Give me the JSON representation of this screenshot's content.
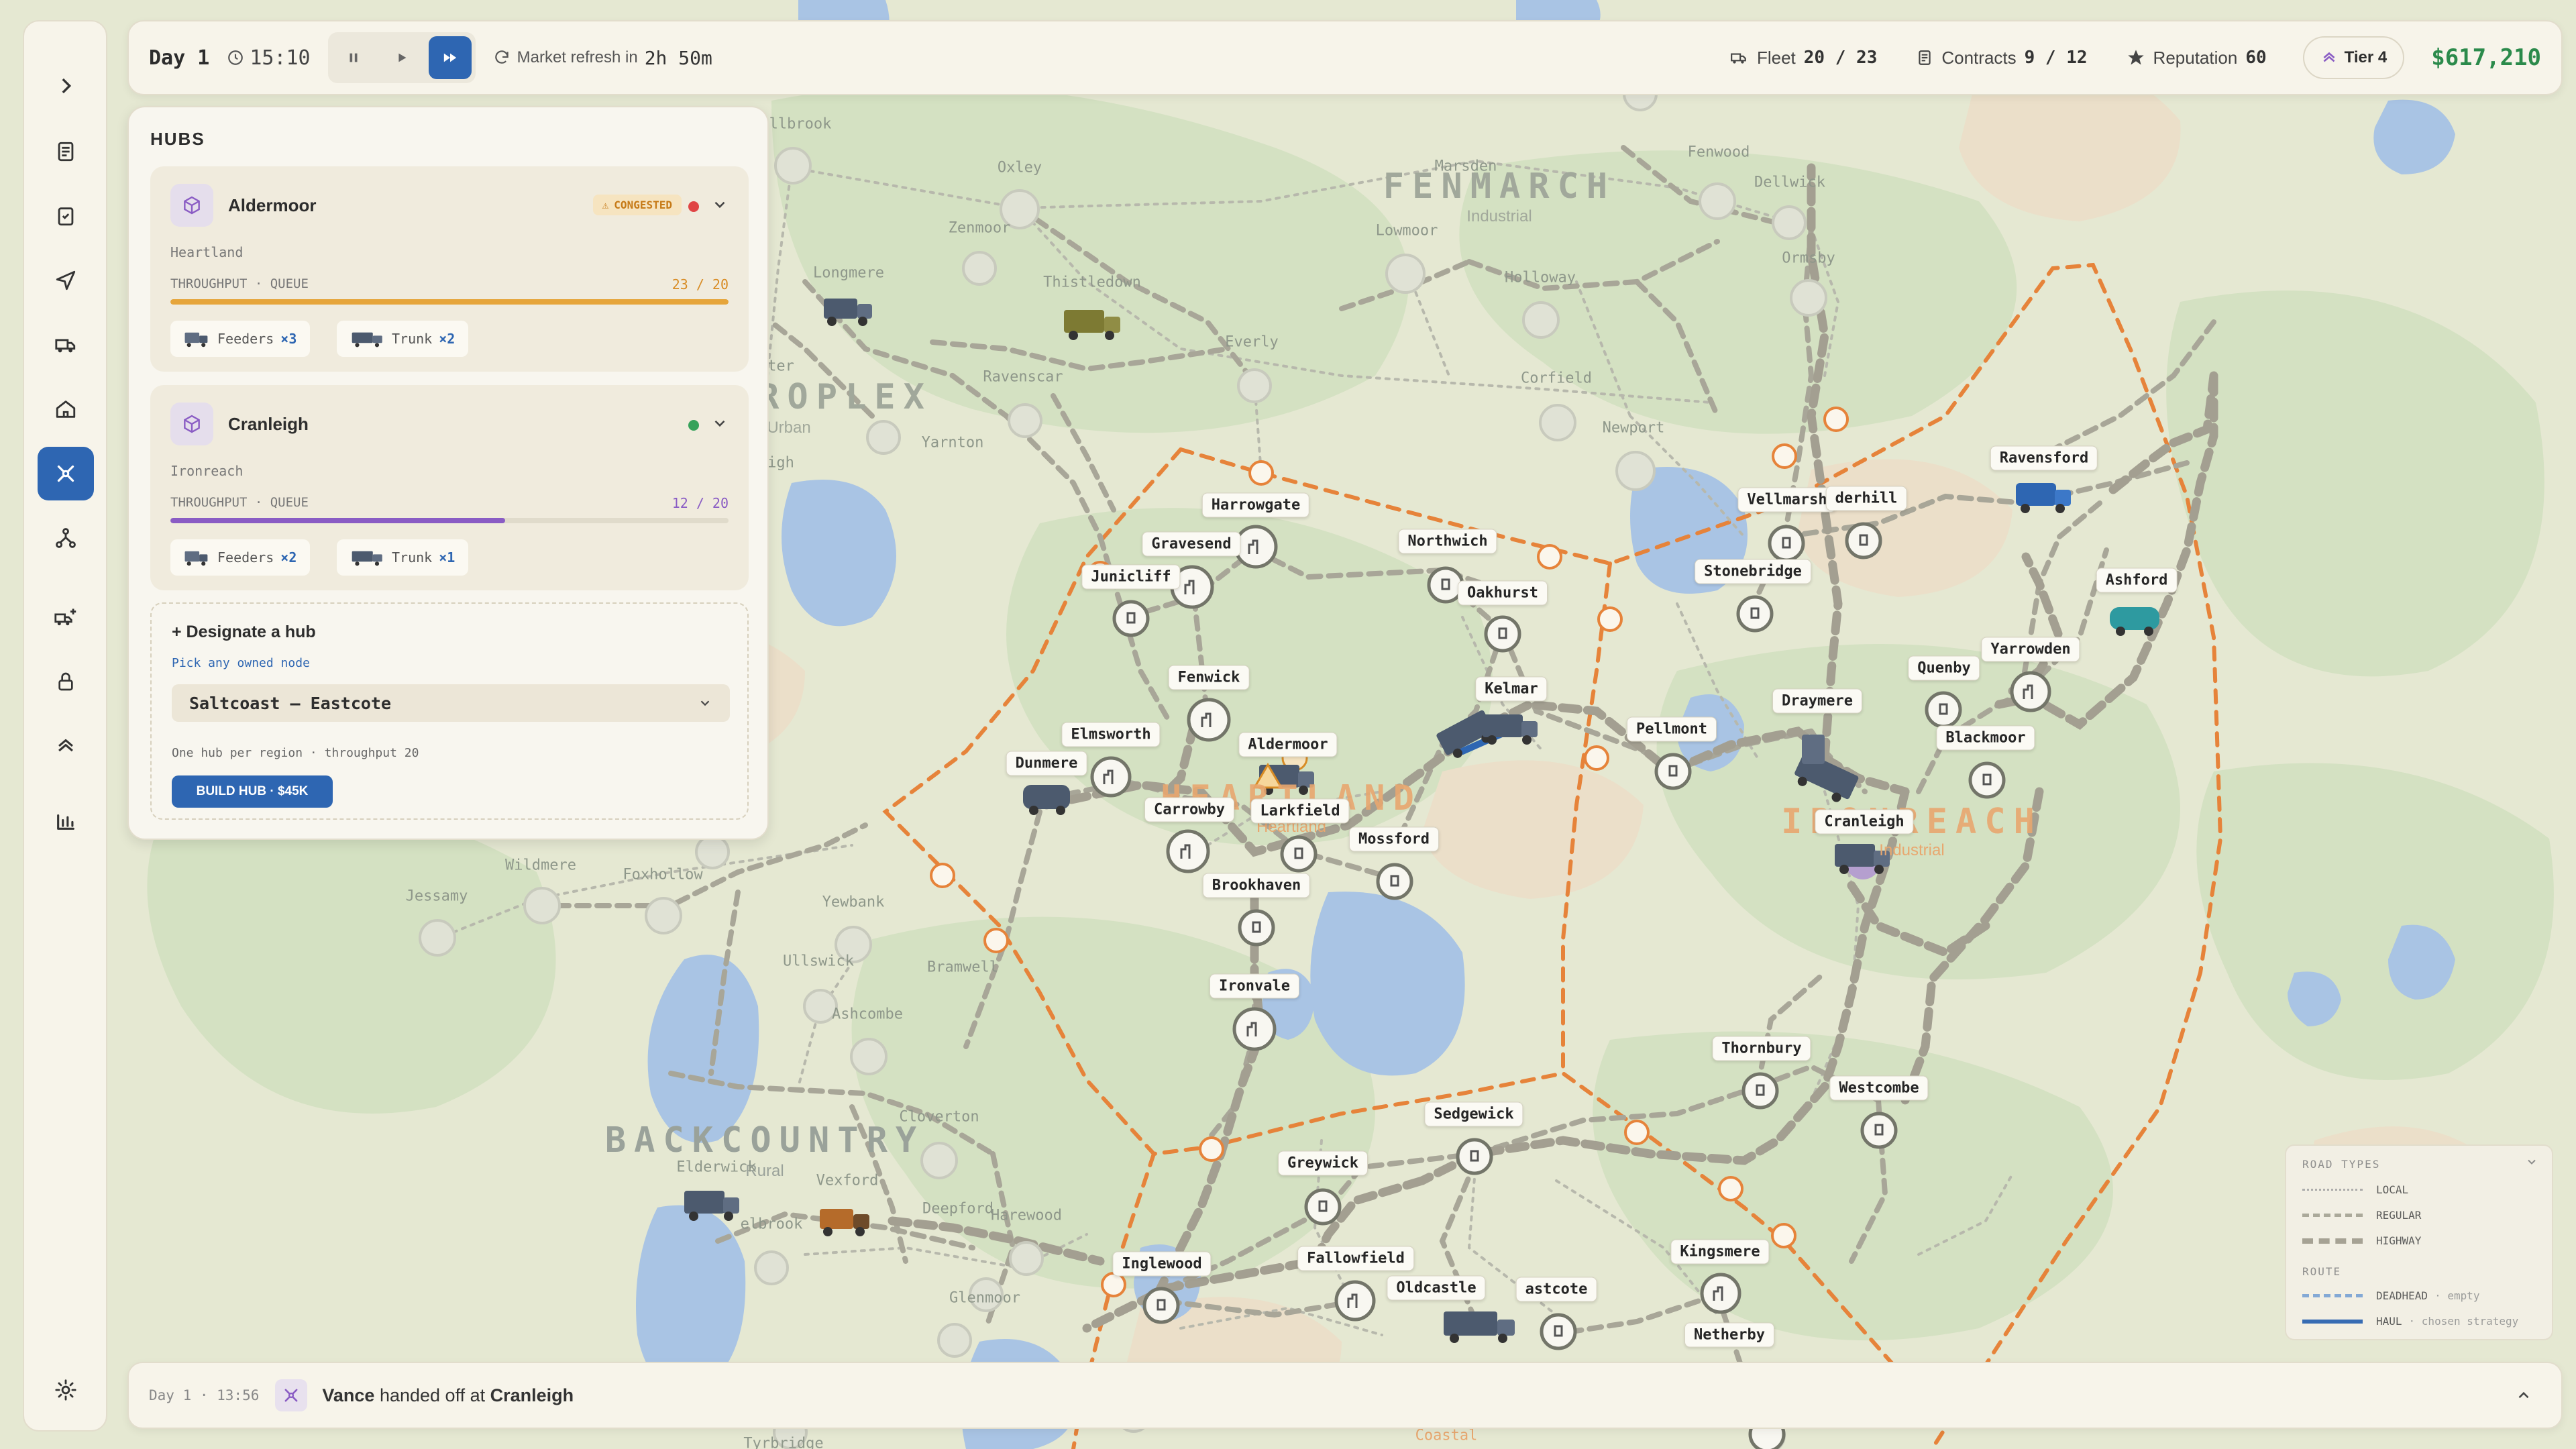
{
  "topbar": {
    "day": "Day 1",
    "time": "15:10",
    "refresh_label": "Market refresh in",
    "refresh_value": "2h 50m",
    "fleet_label": "Fleet",
    "fleet_value": "20 / 23",
    "contracts_label": "Contracts",
    "contracts_value": "9 / 12",
    "reputation_label": "Reputation",
    "reputation_value": "60",
    "tier": "Tier 4",
    "money": "$617,210"
  },
  "hubs_panel": {
    "title": "HUBS",
    "hubs": [
      {
        "name": "Aldermoor",
        "badge": "CONGESTED",
        "status_color": "#e04545",
        "region": "Heartland",
        "throughput_label": "THROUGHPUT · QUEUE",
        "throughput_value": "23 / 20",
        "fill_fraction": 1.0,
        "fill_color": "#e6a53a",
        "feeders_label": "Feeders",
        "feeders_count": "×3",
        "trunk_label": "Trunk",
        "trunk_count": "×2"
      },
      {
        "name": "Cranleigh",
        "badge": "",
        "status_color": "#36a25a",
        "region": "Ironreach",
        "throughput_label": "THROUGHPUT · QUEUE",
        "throughput_value": "12 / 20",
        "fill_fraction": 0.6,
        "fill_color": "#8a5cc4",
        "feeders_label": "Feeders",
        "feeders_count": "×2",
        "trunk_label": "Trunk",
        "trunk_count": "×1"
      }
    ],
    "designate": {
      "title": "+ Designate a hub",
      "hint": "Pick any owned node",
      "selected": "Saltcoast — Eastcote",
      "note": "One hub per region · throughput 20",
      "button": "BUILD HUB · $45K"
    }
  },
  "map": {
    "regions": [
      {
        "name": "FENMARCH",
        "sub": "Industrial",
        "color": "#a1a89b"
      },
      {
        "name": "HEARTLAND",
        "sub": "Heartland",
        "color": "#e8a76f"
      },
      {
        "name": "IRONREACH",
        "sub": "Industrial",
        "color": "#e8a76f"
      },
      {
        "name": "BACKCOUNTRY",
        "sub": "Rural",
        "color": "#9aa29a"
      },
      {
        "name": "ROPLEX",
        "sub": "Urban",
        "color": "#a1a89b"
      }
    ],
    "towns": [
      "Harrowgate",
      "Gravesend",
      "Junicliff",
      "Northwich",
      "Oakhurst",
      "Vellmarsh",
      "derhill",
      "Ravensford",
      "Stonebridge",
      "Ashford",
      "Quenby",
      "Yarrowden",
      "Fenwick",
      "Kelmar",
      "Draymere",
      "Blackmoor",
      "Elmsworth",
      "Aldermoor",
      "Pellmont",
      "Dunmere",
      "Carrowby",
      "Larkfield",
      "Cranleigh",
      "Mossford",
      "Brookhaven",
      "Ironvale",
      "Thornbury",
      "Westcombe",
      "Sedgewick",
      "Greywick",
      "Inglewood",
      "Fallowfield",
      "Kingsmere",
      "Oldcastle",
      "astcote",
      "Netherby"
    ],
    "faded_towns": [
      "llbrook",
      "Oxley",
      "Zenmoor",
      "Thistledown",
      "Longmere",
      "Everly",
      "Ravenscar",
      "Yarnton",
      "Marsden",
      "Lowmoor",
      "Holloway",
      "Fenwood",
      "Dellwick",
      "Ormsby",
      "Corfield",
      "Newport",
      "Wildmere",
      "Foxhollow",
      "Jessamy",
      "Yewbank",
      "Ullswick",
      "Bramwell",
      "Ashcombe",
      "Cloverton",
      "Elderwick",
      "Vexford",
      "elbrook",
      "Deepford",
      "Harewood",
      "Glenmoor",
      "Tyrbridge",
      "Coastal",
      "ter",
      "igh"
    ]
  },
  "legend": {
    "road_types_title": "ROAD TYPES",
    "local": "LOCAL",
    "regular": "REGULAR",
    "highway": "HIGHWAY",
    "route_title": "ROUTE",
    "deadhead": "DEADHEAD",
    "deadhead_desc": "· empty",
    "haul": "HAUL",
    "haul_desc": "· chosen strategy",
    "haul_color": "#2e66b2",
    "deadhead_color": "#7fa6d6"
  },
  "event": {
    "timestamp": "Day 1 · 13:56",
    "actor": "Vance",
    "action": "handed off at",
    "location": "Cranleigh"
  },
  "icons": {
    "sidebar": [
      "chevron-right-icon",
      "clipboard-icon",
      "checklist-icon",
      "send-icon",
      "truck-icon",
      "home-icon",
      "hub-network-icon",
      "branch-icon",
      "add-vehicle-icon",
      "lock-icon",
      "rank-icon",
      "stats-icon",
      "settings-icon"
    ]
  }
}
